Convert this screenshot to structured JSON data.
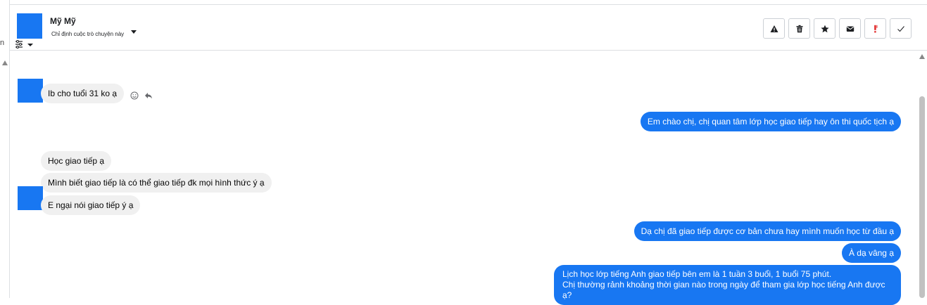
{
  "window": {
    "left_clipped_text": "n"
  },
  "header": {
    "contact_name": "Mỹ Mỹ",
    "assign_label": "Chỉ định cuộc trò chuyện này"
  },
  "actions": [
    {
      "name": "spam",
      "icon": "warning-icon"
    },
    {
      "name": "delete",
      "icon": "trash-icon"
    },
    {
      "name": "star",
      "icon": "star-icon"
    },
    {
      "name": "mark-unread",
      "icon": "envelope-icon"
    },
    {
      "name": "follow-up",
      "icon": "exclamation-icon",
      "color": "#e02020"
    },
    {
      "name": "done",
      "icon": "check-icon"
    }
  ],
  "messages": [
    {
      "direction": "in",
      "text": "Ib cho tuổi 31 ko ạ"
    },
    {
      "direction": "out",
      "text": "Em chào chị, chị quan tâm lớp học giao tiếp hay ôn thi quốc tịch ạ"
    },
    {
      "direction": "in",
      "text": "Học giao tiếp ạ"
    },
    {
      "direction": "in",
      "text": "Mình biết giao tiếp là có thể giao tiếp đk mọi hình thức ý ạ"
    },
    {
      "direction": "in",
      "text": "E ngại nói giao tiếp ý ạ"
    },
    {
      "direction": "out",
      "text": "Dạ chị đã giao tiếp được cơ bản chưa hay mình muốn học từ đầu ạ"
    },
    {
      "direction": "out",
      "text": "À dạ vâng ạ"
    },
    {
      "direction": "out",
      "lines": [
        "Lịch học lớp tiếng Anh giao tiếp bên em là 1 tuần 3 buổi, 1 buổi 75 phút.",
        "Chị thường rảnh khoảng thời gian nào trong ngày để tham gia lớp học tiếng Anh được ạ?"
      ]
    }
  ],
  "colors": {
    "accent": "#1877f2",
    "incoming_bubble": "#f0f0f0",
    "border": "#dddfe2"
  }
}
